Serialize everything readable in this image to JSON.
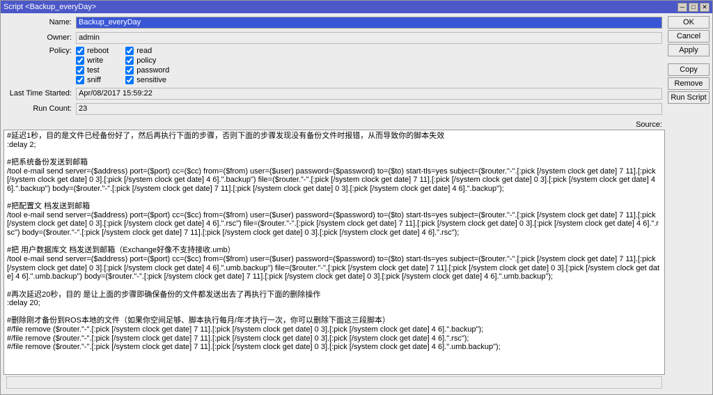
{
  "window": {
    "title": "Script <Backup_everyDay>"
  },
  "buttons": {
    "ok": "OK",
    "cancel": "Cancel",
    "apply": "Apply",
    "copy": "Copy",
    "remove": "Remove",
    "run": "Run Script"
  },
  "labels": {
    "name": "Name:",
    "owner": "Owner:",
    "policy": "Policy:",
    "lastStart": "Last Time Started:",
    "runCount": "Run Count:",
    "source": "Source:"
  },
  "fields": {
    "name": "Backup_everyDay",
    "owner": "admin",
    "lastStart": "Apr/08/2017 15:59:22",
    "runCount": "23"
  },
  "policy": {
    "reboot": "reboot",
    "write": "write",
    "test": "test",
    "sniff": "sniff",
    "read": "read",
    "policy": "policy",
    "password": "password",
    "sensitive": "sensitive"
  },
  "source": "#延迟1秒，目的是文件已经备份好了，然后再执行下面的步骤，否则下面的步骤发现没有备份文件时报错，从而导致你的脚本失效\n:delay 2;\n\n#把系统备份发送到邮箱\n/tool e-mail send server=($address) port=($port) cc=($cc) from=($from) user=($user) password=($password) to=($to) start-tls=yes subject=($router.\"-\".[:pick [/system clock get date] 7 11].[:pick [/system clock get date] 0 3].[:pick [/system clock get date] 4 6].\".backup\") file=($router.\"-\".[:pick [/system clock get date] 7 11].[:pick [/system clock get date] 0 3].[:pick [/system clock get date] 4 6].\".backup\") body=($router.\"-\".[:pick [/system clock get date] 7 11].[:pick [/system clock get date] 0 3].[:pick [/system clock get date] 4 6].\".backup\");\n\n#把配置文 档发送到邮箱\n/tool e-mail send server=($address) port=($port) cc=($cc) from=($from) user=($user) password=($password) to=($to) start-tls=yes subject=($router.\"-\".[:pick [/system clock get date] 7 11].[:pick [/system clock get date] 0 3].[:pick [/system clock get date] 4 6].\".rsc\") file=($router.\"-\".[:pick [/system clock get date] 7 11].[:pick [/system clock get date] 0 3].[:pick [/system clock get date] 4 6].\".rsc\") body=($router.\"-\".[:pick [/system clock get date] 7 11].[:pick [/system clock get date] 0 3].[:pick [/system clock get date] 4 6].\".rsc\");\n\n#把 用户数据库文 档发送到邮箱（Exchange好像不支持接收.umb）\n/tool e-mail send server=($address) port=($port) cc=($cc) from=($from) user=($user) password=($password) to=($to) start-tls=yes subject=($router.\"-\".[:pick [/system clock get date] 7 11].[:pick [/system clock get date] 0 3].[:pick [/system clock get date] 4 6].\".umb.backup\") file=($router.\"-\".[:pick [/system clock get date] 7 11].[:pick [/system clock get date] 0 3].[:pick [/system clock get date] 4 6].\".umb.backup\") body=($router.\"-\".[:pick [/system clock get date] 7 11].[:pick [/system clock get date] 0 3].[:pick [/system clock get date] 4 6].\".umb.backup\");\n\n#再次延迟20秒，目的 是让上面的步骤即确保备份的文件都发送出去了再执行下面的删除操作\n:delay 20;\n\n#删除刚才备份到ROS本地的文件（如果你空间足够、脚本执行每月/年才执行一次，你可以删除下面这三段脚本）\n#/file remove ($router.\"-\".[:pick [/system clock get date] 7 11].[:pick [/system clock get date] 0 3].[:pick [/system clock get date] 4 6].\".backup\");\n#/file remove ($router.\"-\".[:pick [/system clock get date] 7 11].[:pick [/system clock get date] 0 3].[:pick [/system clock get date] 4 6].\".rsc\");\n#/file remove ($router.\"-\".[:pick [/system clock get date] 7 11].[:pick [/system clock get date] 0 3].[:pick [/system clock get date] 4 6].\".umb.backup\");"
}
